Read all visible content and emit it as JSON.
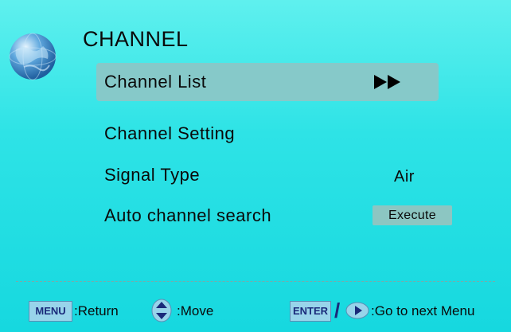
{
  "menu": {
    "title": "CHANNEL",
    "items": [
      {
        "label": "Channel List",
        "value": "",
        "selected": true,
        "control": "arrow"
      },
      {
        "label": "Channel Setting",
        "value": ""
      },
      {
        "label": "Signal Type",
        "value": "Air"
      },
      {
        "label": "Auto channel search",
        "value": "Execute",
        "control": "button"
      }
    ]
  },
  "footer": {
    "menu_key": "MENU",
    "return_label": ":Return",
    "move_label": ":Move",
    "enter_key": "ENTER",
    "separator": "/",
    "next_label": ":Go to next Menu"
  },
  "icons": [
    "globe-icon",
    "double-arrow-icon",
    "up-down-arrows-icon",
    "right-arrow-icon"
  ],
  "colors": {
    "background": "#2ee3e6",
    "highlight": "#86c9c9",
    "key_button": "#98d4ea"
  }
}
